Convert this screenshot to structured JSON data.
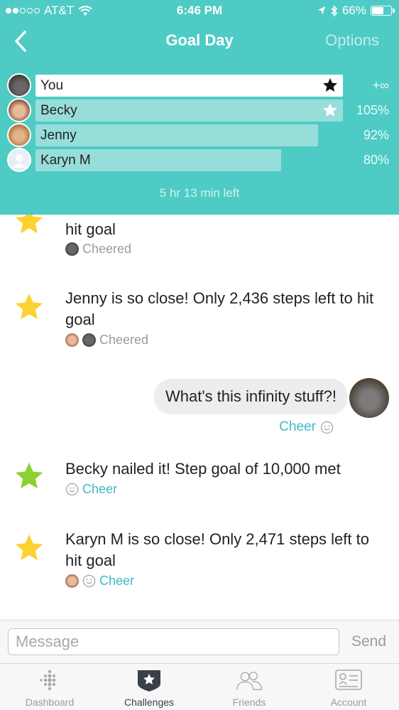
{
  "status_bar": {
    "carrier": "AT&T",
    "time": "6:46 PM",
    "battery": "66%",
    "battery_level": 0.66
  },
  "nav": {
    "title": "Goal Day",
    "options_label": "Options"
  },
  "leaderboard": {
    "rows": [
      {
        "name": "You",
        "percent": "+∞",
        "progress": 1.0
      },
      {
        "name": "Becky",
        "percent": "105%",
        "progress": 1.05
      },
      {
        "name": "Jenny",
        "percent": "92%",
        "progress": 0.92
      },
      {
        "name": "Karyn M",
        "percent": "80%",
        "progress": 0.8
      }
    ],
    "time_left": "5 hr 13 min left"
  },
  "feed": {
    "items": [
      {
        "text": "hit goal",
        "meta": "Cheered"
      },
      {
        "text": "Jenny is so close! Only 2,436 steps left to hit goal",
        "meta": "Cheered"
      },
      {
        "text": "Becky nailed it! Step goal of 10,000 met",
        "meta": "Cheer"
      },
      {
        "text": "Karyn M is so close! Only 2,471 steps left to hit goal",
        "meta": "Cheer"
      }
    ],
    "bubble": {
      "text": "What's this infinity stuff?!",
      "cheer": "Cheer"
    }
  },
  "composer": {
    "placeholder": "Message",
    "send_label": "Send"
  },
  "tabs": [
    {
      "label": "Dashboard",
      "icon": "dashboard-icon"
    },
    {
      "label": "Challenges",
      "icon": "challenges-star-icon"
    },
    {
      "label": "Friends",
      "icon": "friends-icon"
    },
    {
      "label": "Account",
      "icon": "account-card-icon"
    }
  ],
  "colors": {
    "accent": "#4ecbc4",
    "link": "#3fb8c6",
    "star_yellow": "#fdd130",
    "star_green": "#8bd12f"
  }
}
